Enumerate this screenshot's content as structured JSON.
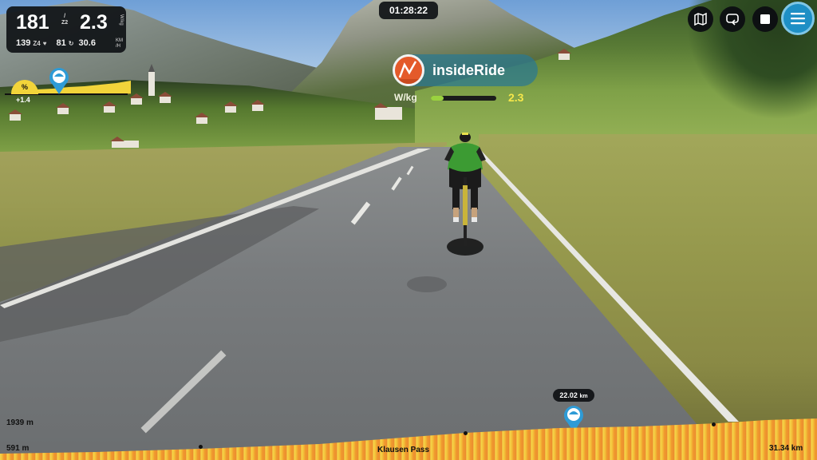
{
  "hud": {
    "power_value": "181",
    "zone_top": "/",
    "zone_bottom": "Z2",
    "wkg_value": "2.3",
    "wkg_unit": "W/kg",
    "heart_rate": "139",
    "heart_zone": "Z4",
    "cadence": "81",
    "speed": "30.6",
    "speed_unit_top": "KM",
    "speed_unit_bottom": "/H"
  },
  "timer": {
    "elapsed": "01:28:22"
  },
  "toolbar": {
    "buttons": [
      {
        "id": "map",
        "icon": "map-icon"
      },
      {
        "id": "loop",
        "icon": "repeat-icon"
      },
      {
        "id": "stop",
        "icon": "stop-icon"
      },
      {
        "id": "menu",
        "icon": "menu-icon"
      }
    ],
    "menu_color": "#1e8fc5"
  },
  "brand": {
    "name": "insideRide",
    "logo_color": "#e45a2a"
  },
  "wkg_bar": {
    "label": "W/kg",
    "value": "2.3",
    "fill_fraction": 0.2,
    "fill_color": "#9ad23f"
  },
  "grade": {
    "symbol": "%",
    "delta": "+1.4",
    "accent": "#f2d43a"
  },
  "distance_marker": {
    "label": "22.02",
    "unit": "km"
  },
  "profile": {
    "max_elevation": "1939 m",
    "min_elevation": "591 m",
    "segment_name": "Klausen Pass",
    "total_distance": "31.34 km"
  }
}
